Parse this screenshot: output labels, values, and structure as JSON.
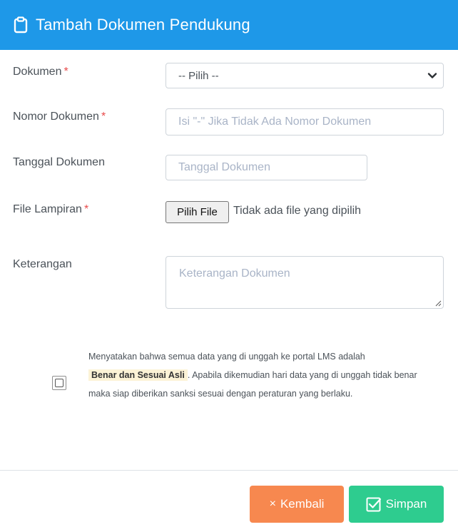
{
  "header": {
    "title": "Tambah Dokumen Pendukung",
    "icon": "clipboard-icon",
    "bg_color": "#1e98e8"
  },
  "form": {
    "dokumen": {
      "label": "Dokumen",
      "required_mark": "*",
      "selected": "-- Pilih --"
    },
    "nomor": {
      "label": "Nomor Dokumen",
      "required_mark": "*",
      "placeholder": "Isi \"-\" Jika Tidak Ada Nomor Dokumen"
    },
    "tanggal": {
      "label": "Tanggal Dokumen",
      "placeholder": "Tanggal Dokumen"
    },
    "lampiran": {
      "label": "File Lampiran",
      "required_mark": "*",
      "button": "Pilih File",
      "status": "Tidak ada file yang dipilih"
    },
    "keterangan": {
      "label": "Keterangan",
      "placeholder": "Keterangan Dokumen"
    }
  },
  "agreement": {
    "text_before": "Menyatakan bahwa semua data yang di unggah ke portal LMS adalah",
    "highlight": "Benar dan Sesuai Asli",
    "text_after": ". Apabila dikemudian hari data yang di unggah tidak benar maka siap diberikan sanksi sesuai dengan peraturan yang berlaku.",
    "checked": false
  },
  "footer": {
    "back_label": "Kembali",
    "back_icon": "×",
    "save_label": "Simpan",
    "back_color": "#f7884f",
    "save_color": "#2ecc8f"
  }
}
